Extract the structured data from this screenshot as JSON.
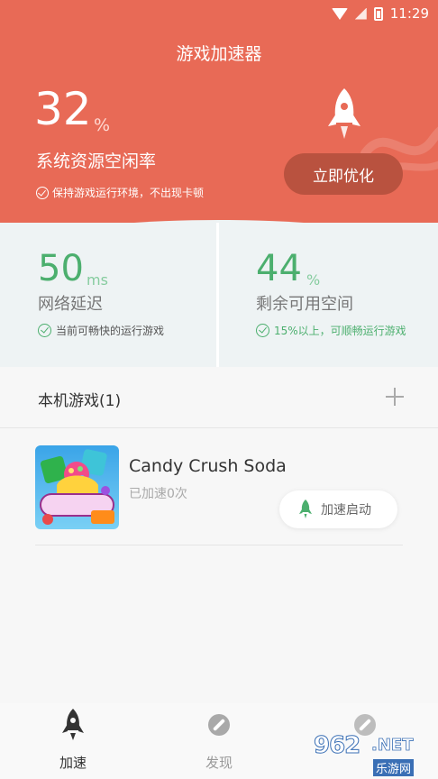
{
  "status_bar": {
    "time": "11:29"
  },
  "header": {
    "title": "游戏加速器",
    "resource_value": "32",
    "resource_unit": "%",
    "resource_label": "系统资源空闲率",
    "resource_hint": "保持游戏运行环境，不出现卡顿",
    "optimize_button": "立即优化"
  },
  "metrics": {
    "latency": {
      "value": "50",
      "unit": "ms",
      "label": "网络延迟",
      "hint": "当前可畅快的运行游戏"
    },
    "space": {
      "value": "44",
      "unit": "%",
      "label": "剩余可用空间",
      "hint": "15%以上，可顺畅运行游戏"
    }
  },
  "section": {
    "title": "本机游戏(1)"
  },
  "games": [
    {
      "name": "Candy Crush Soda",
      "status": "已加速0次",
      "boost_button": "加速启动"
    }
  ],
  "bottom_nav": {
    "items": [
      {
        "label": "加速",
        "icon": "rocket-icon",
        "active": true
      },
      {
        "label": "发现",
        "icon": "compass-icon",
        "active": false
      }
    ]
  },
  "watermark": {
    "brand": "962",
    "suffix": ".NET",
    "cn": "乐游网"
  },
  "colors": {
    "accent": "#e86a56",
    "green": "#4caf6e",
    "metrics_bg": "#eef3f4"
  }
}
